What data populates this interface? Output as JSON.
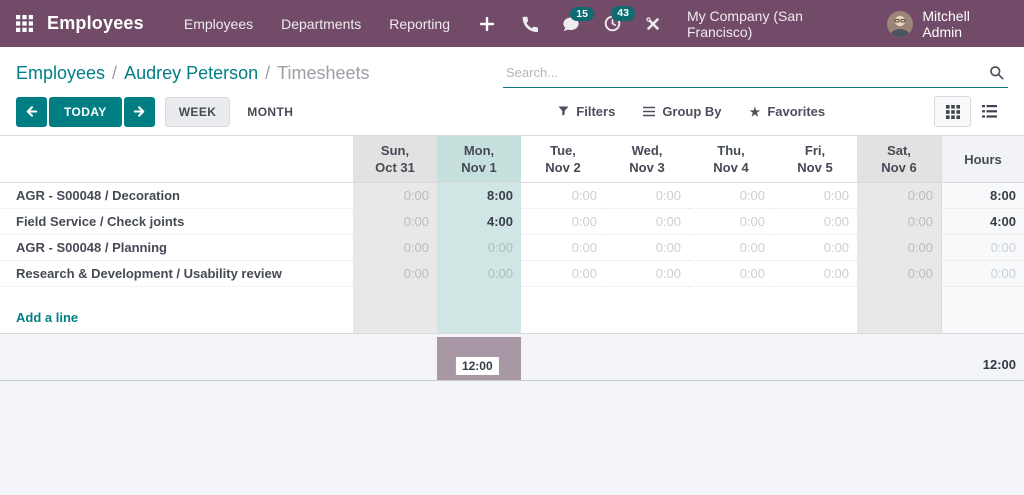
{
  "navbar": {
    "brand": "Employees",
    "menu_items": {
      "employees": "Employees",
      "departments": "Departments",
      "reporting": "Reporting"
    },
    "badges": {
      "messages": "15",
      "activities": "43"
    },
    "company": "My Company (San Francisco)",
    "user": "Mitchell Admin"
  },
  "breadcrumb": {
    "items": [
      "Employees",
      "Audrey Peterson",
      "Timesheets"
    ],
    "separator": "/"
  },
  "search": {
    "placeholder": "Search..."
  },
  "controls": {
    "today": "TODAY",
    "week": "WEEK",
    "month": "MONTH",
    "filters": "Filters",
    "group_by": "Group By",
    "favorites": "Favorites",
    "star_glyph": "★"
  },
  "grid": {
    "columns": [
      {
        "day": "Sun,",
        "date": "Oct 31",
        "type": "weekend"
      },
      {
        "day": "Mon,",
        "date": "Nov 1",
        "type": "today"
      },
      {
        "day": "Tue,",
        "date": "Nov 2",
        "type": "normal"
      },
      {
        "day": "Wed,",
        "date": "Nov 3",
        "type": "normal"
      },
      {
        "day": "Thu,",
        "date": "Nov 4",
        "type": "normal"
      },
      {
        "day": "Fri,",
        "date": "Nov 5",
        "type": "normal"
      },
      {
        "day": "Sat,",
        "date": "Nov 6",
        "type": "weekend"
      }
    ],
    "hours_label": "Hours",
    "rows": [
      {
        "label": "AGR - S00048 / Decoration",
        "values": [
          "0:00",
          "8:00",
          "0:00",
          "0:00",
          "0:00",
          "0:00",
          "0:00"
        ],
        "total": "8:00"
      },
      {
        "label": "Field Service / Check joints",
        "values": [
          "0:00",
          "4:00",
          "0:00",
          "0:00",
          "0:00",
          "0:00",
          "0:00"
        ],
        "total": "4:00"
      },
      {
        "label": "AGR - S00048 / Planning",
        "values": [
          "0:00",
          "0:00",
          "0:00",
          "0:00",
          "0:00",
          "0:00",
          "0:00"
        ],
        "total": "0:00"
      },
      {
        "label": "Research & Development / Usability review",
        "values": [
          "0:00",
          "0:00",
          "0:00",
          "0:00",
          "0:00",
          "0:00",
          "0:00"
        ],
        "total": "0:00"
      }
    ],
    "add_line": "Add a line",
    "footer": {
      "bar_label": "12:00",
      "total": "12:00"
    }
  },
  "colors": {
    "navbar_bg": "#714B67",
    "primary_teal": "#017e84",
    "badge_bg": "#0c6c70",
    "today_column_bg": "#cfe6e4",
    "weekend_column_bg": "#e8e8e8",
    "footer_bar": "#a897a5"
  }
}
